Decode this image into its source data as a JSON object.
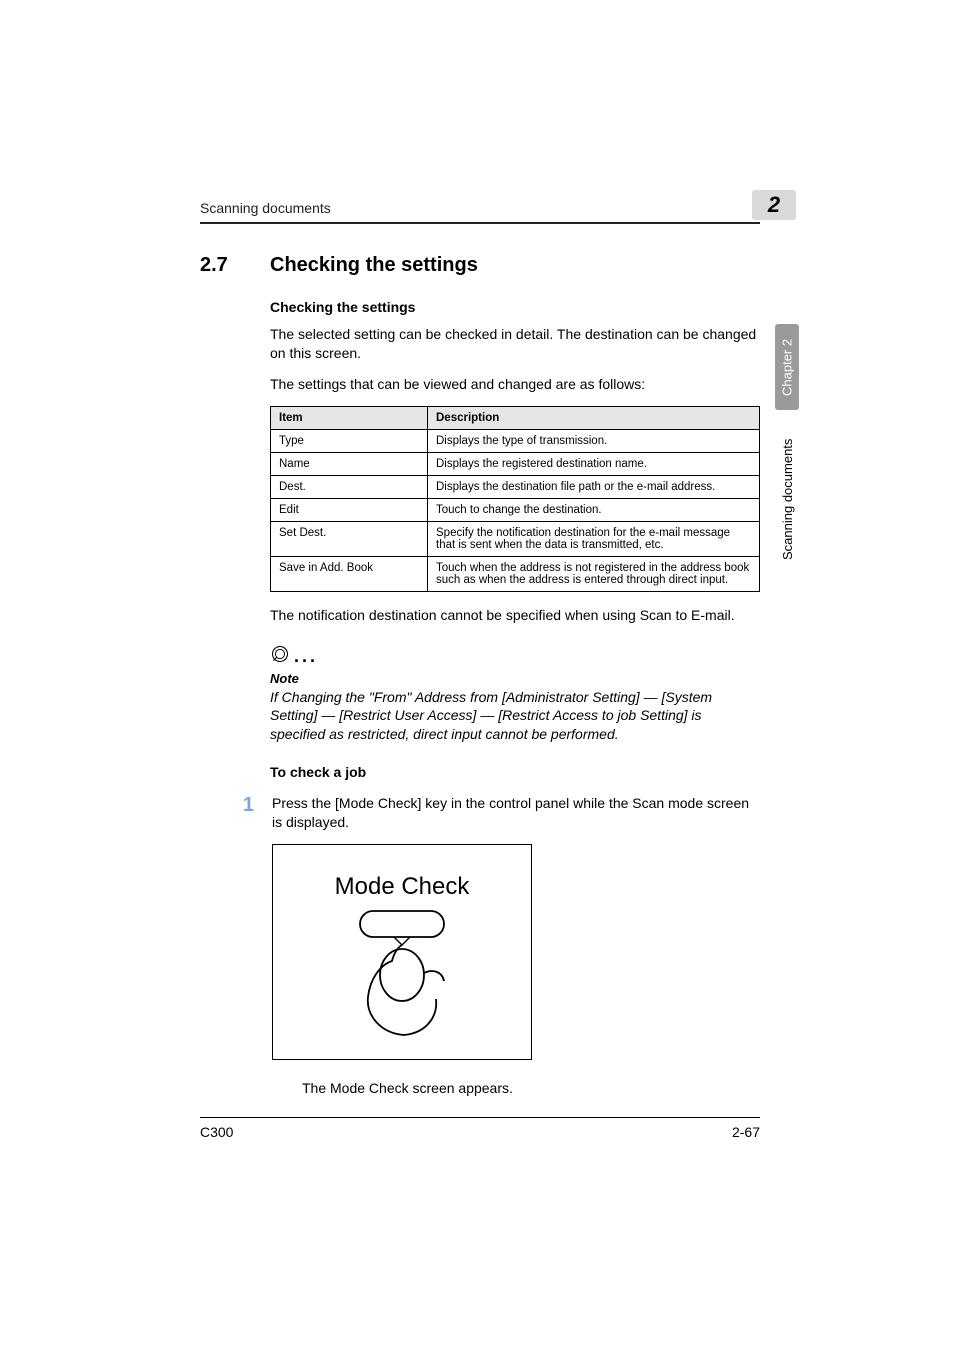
{
  "running_head": "Scanning documents",
  "chapter_badge": "2",
  "section": {
    "number": "2.7",
    "title": "Checking the settings"
  },
  "sub1": "Checking the settings",
  "para1": "The selected setting can be checked in detail. The destination can be changed on this screen.",
  "para2": "The settings that can be viewed and changed are as follows:",
  "table": {
    "headers": [
      "Item",
      "Description"
    ],
    "rows": [
      [
        "Type",
        "Displays the type of transmission."
      ],
      [
        "Name",
        "Displays the registered destination name."
      ],
      [
        "Dest.",
        "Displays the destination file path or the e-mail address."
      ],
      [
        "Edit",
        "Touch to change the destination."
      ],
      [
        "Set Dest.",
        "Specify the notification destination for the e-mail message that is sent when the data is transmitted, etc."
      ],
      [
        "Save in Add. Book",
        "Touch when the address is not registered in the address book such as when the address is entered through direct input."
      ]
    ]
  },
  "para3": "The notification destination cannot be specified when using Scan to E-mail.",
  "note": {
    "label": "Note",
    "text": "If Changing the \"From\" Address from [Administrator Setting] — [System Setting] — [Restrict User Access] — [Restrict Access to job Setting] is specified as restricted, direct input cannot be performed."
  },
  "proc_heading": "To check a job",
  "step1": {
    "num": "1",
    "text": "Press the [Mode Check] key in the control panel while the Scan mode screen is displayed."
  },
  "figure_label": "Mode Check",
  "result_text": "The Mode Check screen appears.",
  "footer": {
    "left": "C300",
    "right": "2-67"
  },
  "side": {
    "tab": "Chapter 2",
    "text": "Scanning documents"
  }
}
